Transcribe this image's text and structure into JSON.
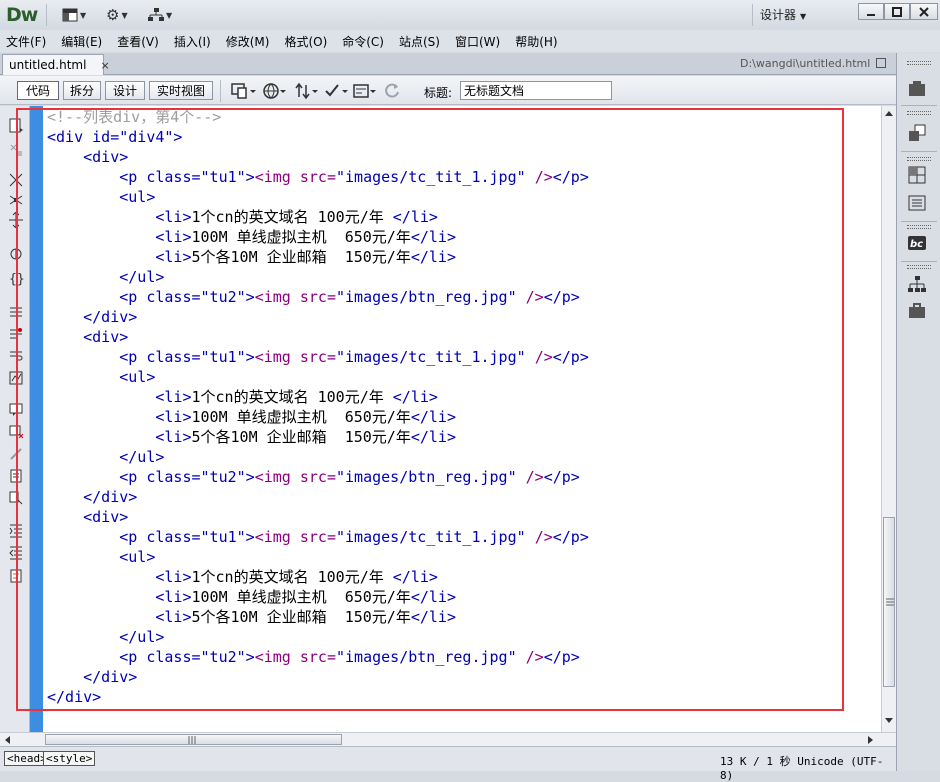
{
  "app": {
    "logo": "Dw",
    "workspace_label": "设计器",
    "window_controls": {
      "minimize_icon": "minimize-icon",
      "maximize_icon": "maximize-icon",
      "close_icon": "close-icon"
    }
  },
  "menubar": {
    "items": [
      "文件(F)",
      "编辑(E)",
      "查看(V)",
      "插入(I)",
      "修改(M)",
      "格式(O)",
      "命令(C)",
      "站点(S)",
      "窗口(W)",
      "帮助(H)"
    ]
  },
  "document": {
    "tab_label": "untitled.html",
    "tab_close": "×",
    "path": "D:\\wangdi\\untitled.html"
  },
  "doc_toolbar": {
    "views": [
      "代码",
      "拆分",
      "设计",
      "实时视图"
    ],
    "active_view": "代码",
    "title_label": "标题:",
    "title_value": "无标题文档"
  },
  "code_lines": [
    "<!--列表div，第4个-->",
    "<div id=\"div4\">",
    "    <div>",
    "        <p class=\"tu1\"><img src=\"images/tc_tit_1.jpg\" /></p>",
    "        <ul>",
    "            <li>1个cn的英文域名 100元/年 </li>",
    "            <li>100M 单线虚拟主机  650元/年</li>",
    "            <li>5个各10M 企业邮箱  150元/年</li>",
    "        </ul>",
    "        <p class=\"tu2\"><img src=\"images/btn_reg.jpg\" /></p>",
    "    </div>",
    "    <div>",
    "        <p class=\"tu1\"><img src=\"images/tc_tit_1.jpg\" /></p>",
    "        <ul>",
    "            <li>1个cn的英文域名 100元/年 </li>",
    "            <li>100M 单线虚拟主机  650元/年</li>",
    "            <li>5个各10M 企业邮箱  150元/年</li>",
    "        </ul>",
    "        <p class=\"tu2\"><img src=\"images/btn_reg.jpg\" /></p>",
    "    </div>",
    "    <div>",
    "        <p class=\"tu1\"><img src=\"images/tc_tit_1.jpg\" /></p>",
    "        <ul>",
    "            <li>1个cn的英文域名 100元/年 </li>",
    "            <li>100M 单线虚拟主机  650元/年</li>",
    "            <li>5个各10M 企业邮箱  150元/年</li>",
    "        </ul>",
    "        <p class=\"tu2\"><img src=\"images/btn_reg.jpg\" /></p>",
    "    </div>",
    "</div>"
  ],
  "statusbar": {
    "crumbs": [
      "<head>",
      "<style>"
    ],
    "info": "13 K / 1 秒  Unicode (UTF-8)"
  },
  "colors": {
    "code_tag": "#0000b4",
    "code_comment": "#9e9e9e",
    "code_img": "#8b0080",
    "gutter": "#3d8de0",
    "highlight_box": "#e8333e"
  }
}
